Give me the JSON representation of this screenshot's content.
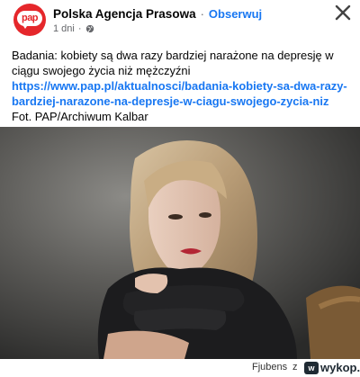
{
  "header": {
    "page_name": "Polska Agencja Prasowa",
    "separator": "·",
    "follow_label": "Obserwuj",
    "time_ago": "1 dni",
    "dot": "·",
    "avatar_text": "pap"
  },
  "post": {
    "text": "Badania: kobiety są dwa razy bardziej narażone na depresję w ciągu swojego życia niż mężczyźni",
    "link": "https://www.pap.pl/aktualnosci/badania-kobiety-sa-dwa-razy-bardziej-narazone-na-depresje-w-ciagu-swojego-zycia-niz",
    "credit": "Fot. PAP/Archiwum Kalbar"
  },
  "footer": {
    "username": "Fjubens",
    "z": "z",
    "site": "wykop.pl",
    "badge": "w"
  },
  "colors": {
    "accent": "#1877f2",
    "brand_red": "#e5272b",
    "text": "#050505",
    "muted": "#65676b"
  },
  "icons": {
    "globe": "globe-icon",
    "close": "close-icon"
  }
}
